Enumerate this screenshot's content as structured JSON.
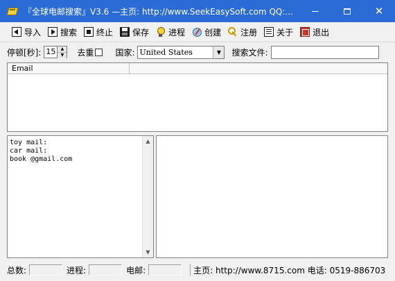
{
  "window": {
    "title": "『全球电邮搜索』V3.6  —主页: http://www.SeekEasySoft.com QQ:..."
  },
  "toolbar": {
    "items": [
      {
        "label": "导入",
        "icon": "import-icon"
      },
      {
        "label": "搜索",
        "icon": "search-play-icon"
      },
      {
        "label": "终止",
        "icon": "stop-icon"
      },
      {
        "label": "保存",
        "icon": "save-icon"
      },
      {
        "label": "进程",
        "icon": "bulb-icon"
      },
      {
        "label": "创建",
        "icon": "create-icon"
      },
      {
        "label": "注册",
        "icon": "key-icon"
      },
      {
        "label": "关于",
        "icon": "about-icon"
      },
      {
        "label": "退出",
        "icon": "exit-icon"
      }
    ]
  },
  "options": {
    "delay_label": "停顿[秒]:",
    "delay_value": "15",
    "dedupe_label": "去重",
    "country_label": "国家:",
    "country_value": "United States",
    "search_file_label": "搜索文件:"
  },
  "email_list": {
    "columns": [
      "Email",
      ""
    ]
  },
  "keywords": {
    "lines": [
      "toy mail:",
      "car mail:",
      "book @gmail.com"
    ]
  },
  "statusbar": {
    "total_label": "总数:",
    "progress_label": "进程:",
    "email_label": "电邮:",
    "home_info": "主页: http://www.8715.com 电话: 0519-886703"
  }
}
